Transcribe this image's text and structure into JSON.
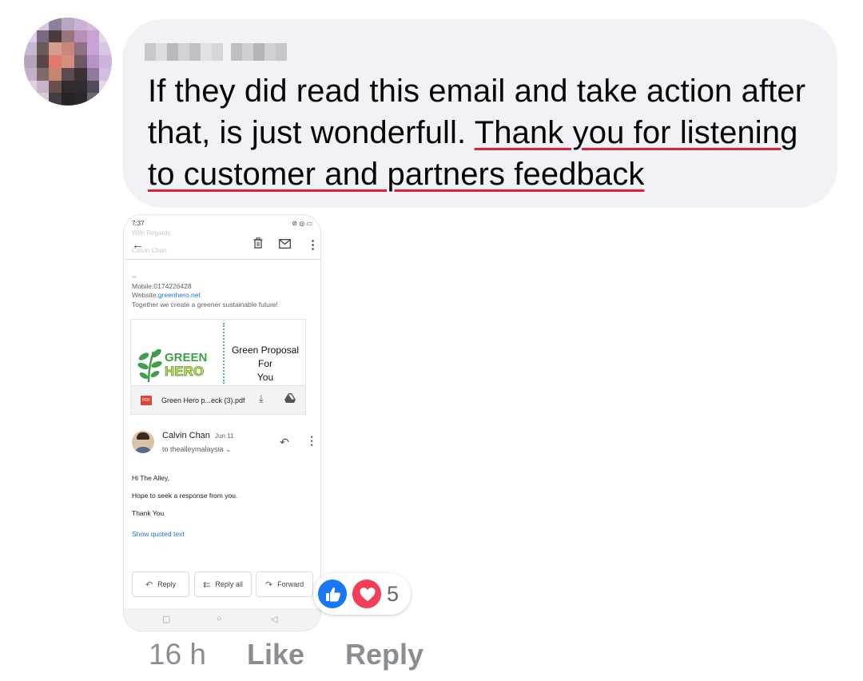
{
  "comment": {
    "text_plain": "If they did read this email and take action after that, is just wonderfull. ",
    "text_underlined": "Thank you for listening to customer and partners feedback"
  },
  "screenshot": {
    "status_time": "7:37",
    "ghost_regards": "With Regards",
    "ghost_name": "Calvin Chan",
    "signature": {
      "dash": "--",
      "mobile": "Mobile:0174226428",
      "website_label": "Website:",
      "website_link": "greenhero.net",
      "tagline": "Together we create a greener sustainable future!"
    },
    "card": {
      "logo_line1": "GREEN",
      "logo_line2": "HERO",
      "proposal_line1": "Green Proposal",
      "proposal_line2": "For",
      "proposal_line3": "You",
      "attachment_name": "Green Hero p...eck (3).pdf",
      "pdf_badge": "PDF"
    },
    "sender": {
      "name": "Calvin Chan",
      "date": "Jun 11",
      "to": "to thealleymalaysia ⌄"
    },
    "body": {
      "greeting": "Hi The Alley,",
      "line1": "Hope to seek a response from you.",
      "line2": "Thank You",
      "quoted": "Show quoted text"
    },
    "actions": {
      "reply": "Reply",
      "reply_all": "Reply all",
      "forward": "Forward"
    }
  },
  "reactions": {
    "count": "5",
    "types": [
      "like",
      "love"
    ]
  },
  "footer": {
    "time": "16 h",
    "like": "Like",
    "reply": "Reply"
  },
  "colors": {
    "bubble_bg": "#f0f2f5",
    "underline": "#e41e3f",
    "like_blue": "#1877f2",
    "love_red": "#f33e58",
    "meta_gray": "#8a8d91"
  },
  "icons": [
    "back-arrow-icon",
    "trash-icon",
    "mail-icon",
    "more-vert-icon",
    "download-icon",
    "drive-icon",
    "reply-icon",
    "reply-all-icon",
    "forward-icon",
    "like-icon",
    "love-icon"
  ]
}
